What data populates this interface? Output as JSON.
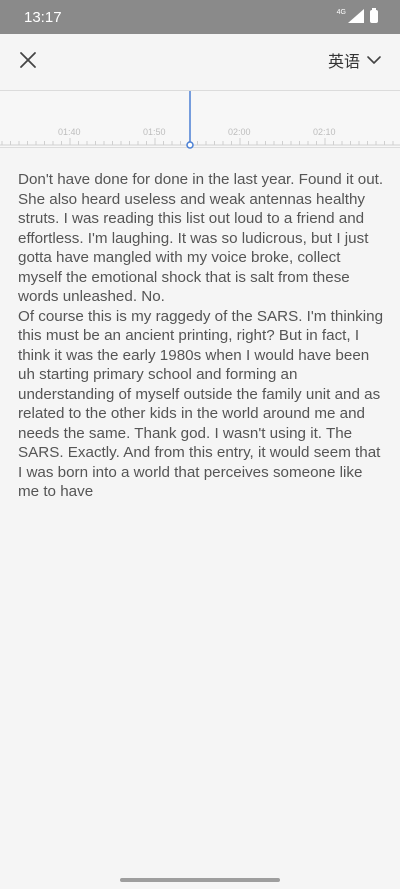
{
  "status_bar": {
    "time": "13:17",
    "network_label": "4G",
    "icons": [
      "signal-icon",
      "battery-icon"
    ]
  },
  "toolbar": {
    "close_icon": "close-icon",
    "language": "英语",
    "dropdown_icon": "chevron-down-icon"
  },
  "timeline": {
    "labels": [
      "01:40",
      "01:50",
      "02:00",
      "02:10"
    ],
    "playhead_color": "#4a7fd4"
  },
  "transcript": {
    "paragraphs": [
      "Don't have done for done in the last year. Found it out. She also heard useless and weak antennas healthy struts. I was reading this list out loud to a friend and effortless. I'm laughing. It was so ludicrous, but I just gotta have mangled with my voice broke, collect myself the emotional shock that is salt from these words unleashed. No.",
      "Of course this is my raggedy of the SARS. I'm thinking this must be an ancient printing, right? But in fact, I think it was the early 1980s when I would have been uh starting primary school and forming an understanding of myself outside the family unit and as related to the other kids in the world around me and needs the same. Thank god. I wasn't using it. The SARS. Exactly. And from this entry, it would seem that I was born into a world that perceives someone like me to have"
    ]
  }
}
